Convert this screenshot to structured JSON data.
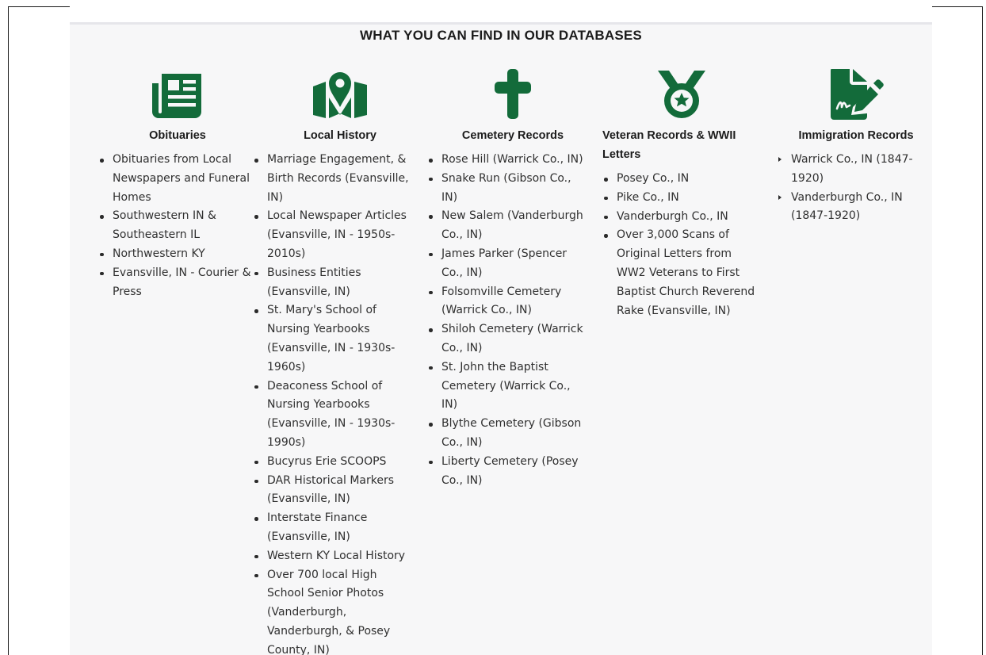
{
  "section": {
    "heading": "WHAT YOU CAN FIND IN OUR DATABASES"
  },
  "colors": {
    "icon_green": "#136b3a"
  },
  "columns": [
    {
      "icon": "newspaper-icon",
      "title": "Obituaries",
      "items": [
        "Obituaries from Local Newspapers and Funeral Homes",
        "Southwestern IN & Southeastern IL",
        "Northwestern KY",
        "Evansville, IN - Courier & Press"
      ]
    },
    {
      "icon": "map-pin-icon",
      "title": "Local History",
      "items": [
        "Marriage Engagement, & Birth Records (Evansville, IN)",
        "Local Newspaper Articles (Evansville, IN - 1950s-2010s)",
        "Business Entities (Evansville, IN)",
        "St. Mary's School of Nursing Yearbooks (Evansville, IN - 1930s-1960s)",
        "Deaconess School of Nursing Yearbooks (Evansville, IN - 1930s-1990s)",
        "Bucyrus Erie SCOOPS",
        "DAR Historical Markers (Evansville, IN)",
        "Interstate Finance (Evansville, IN)",
        "Western KY Local History",
        "Over 700 local High School Senior Photos (Vanderburgh, Vanderburgh, & Posey County, IN)"
      ]
    },
    {
      "icon": "cross-icon",
      "title": "Cemetery Records",
      "items": [
        "Rose Hill (Warrick Co., IN)",
        "Snake Run (Gibson Co., IN)",
        "New Salem (Vanderburgh Co., IN)",
        "James Parker (Spencer Co., IN)",
        "Folsomville Cemetery (Warrick Co., IN)",
        "Shiloh Cemetery (Warrick Co., IN)",
        "St. John the Baptist Cemetery (Warrick Co., IN)",
        "Blythe Cemetery (Gibson Co., IN)",
        "Liberty Cemetery (Posey Co., IN)"
      ]
    },
    {
      "icon": "medal-icon",
      "title": "Veteran Records & WWII Letters",
      "items": [
        "Posey Co., IN",
        "Pike Co., IN",
        "Vanderburgh Co., IN",
        "Over 3,000 Scans of Original Letters from WW2 Veterans to First Baptist Church Reverend Rake (Evansville, IN)"
      ]
    },
    {
      "icon": "signed-document-icon",
      "title": "Immigration Records",
      "items": [
        "Warrick Co., IN (1847-1920)",
        "Vanderburgh Co., IN (1847-1920)"
      ]
    }
  ]
}
